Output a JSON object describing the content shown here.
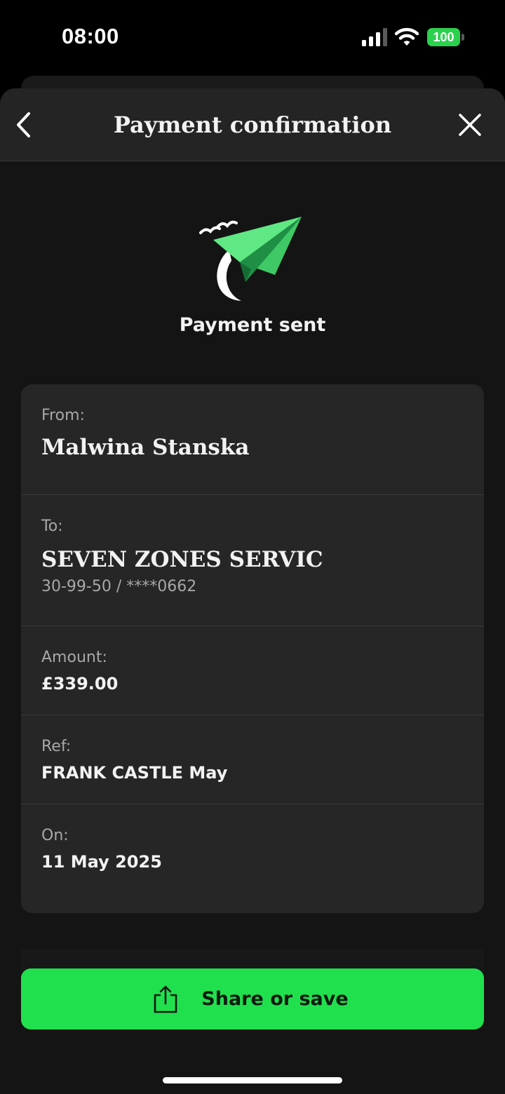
{
  "status_bar": {
    "time": "08:00",
    "battery": "100",
    "icons": [
      "signal-icon",
      "wifi-icon",
      "battery-icon"
    ],
    "battery_color": "#2bd14d"
  },
  "header": {
    "title": "Payment confirmation",
    "back_icon": "chevron-left-icon",
    "close_icon": "close-icon"
  },
  "hero": {
    "icon": "paper-plane-icon",
    "label": "Payment sent"
  },
  "details": {
    "from": {
      "label": "From:",
      "value": "Malwina Stanska"
    },
    "to": {
      "label": "To:",
      "value": "SEVEN ZONES SERVIC",
      "account": "30-99-50 / ****0662"
    },
    "amount": {
      "label": "Amount:",
      "value": "£339.00"
    },
    "ref": {
      "label": "Ref:",
      "value": "FRANK CASTLE May"
    },
    "on": {
      "label": "On:",
      "value": "11 May 2025"
    }
  },
  "actions": {
    "share_label": "Share or save",
    "share_icon": "share-icon",
    "accent_color": "#21e04e"
  }
}
